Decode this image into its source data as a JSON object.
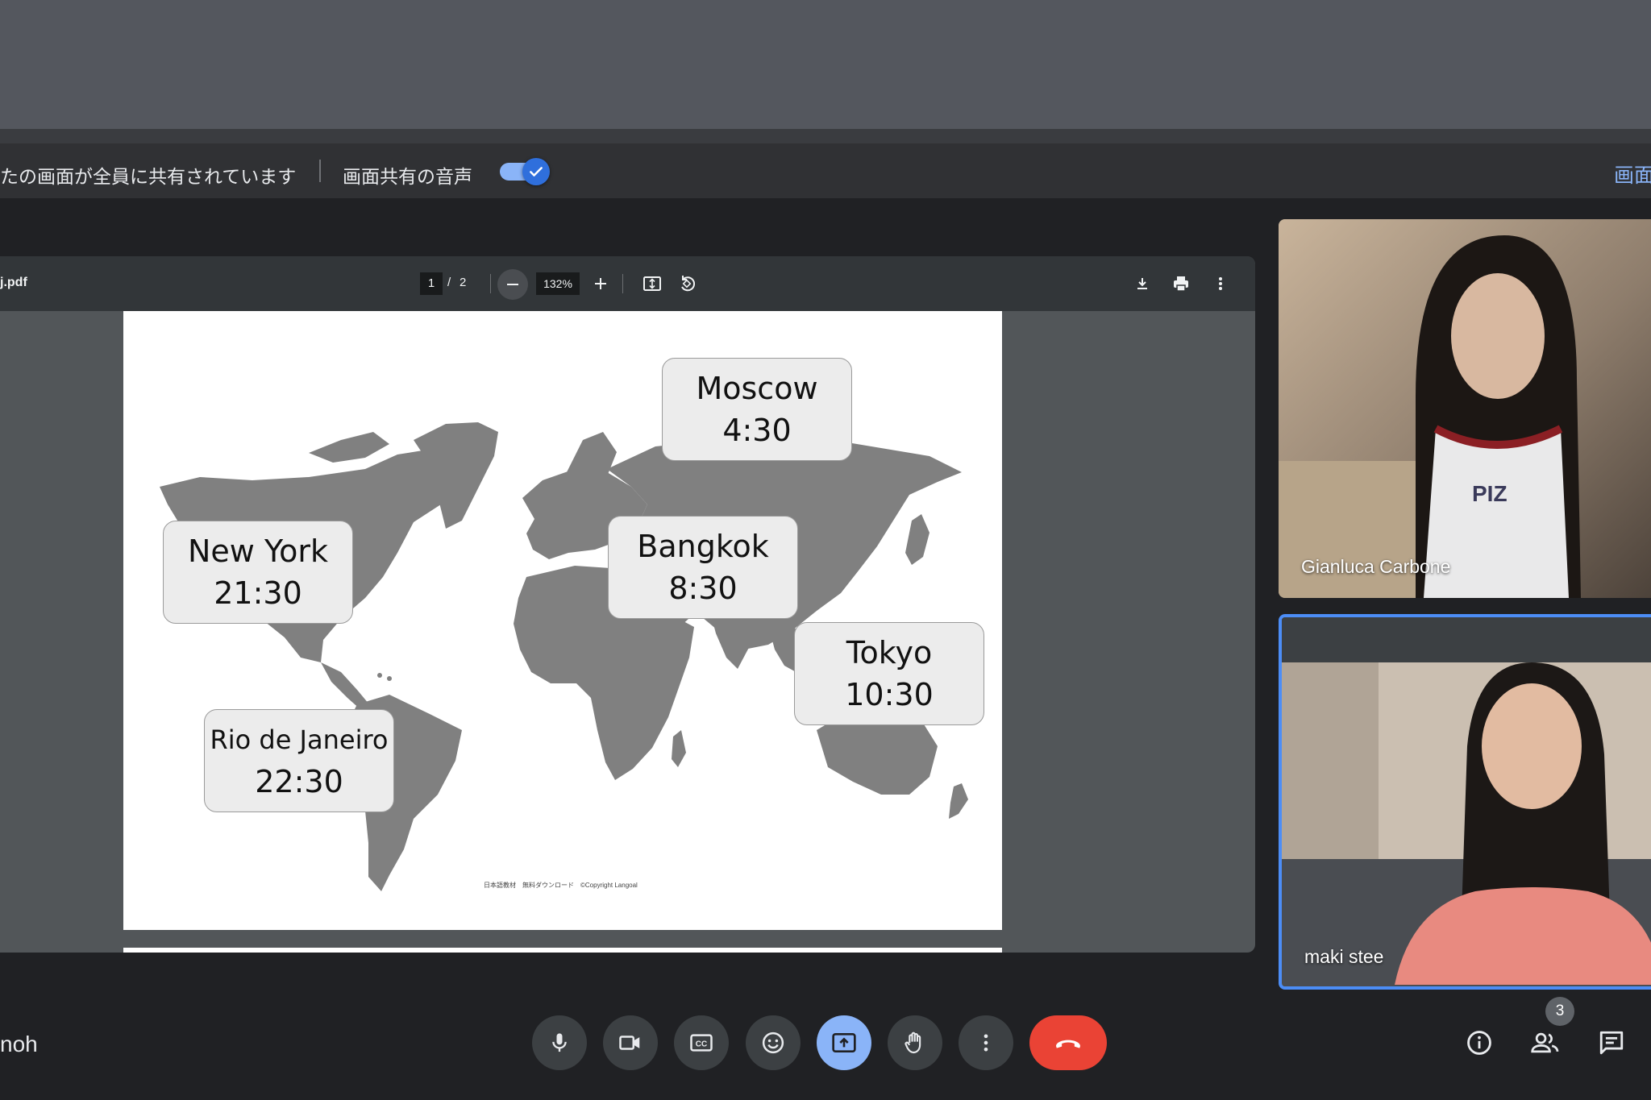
{
  "banner": {
    "share_message": "たの画面が全員に共有されています",
    "audio_label": "画面共有の音声",
    "audio_toggle_on": true,
    "right_link": "画面"
  },
  "pdf": {
    "filename": "j.pdf",
    "page_current": "1",
    "page_separator": "/",
    "page_total": "2",
    "zoom": "132%",
    "icons": [
      "zoom-out-icon",
      "zoom-in-icon",
      "fit-page-icon",
      "rotate-icon",
      "download-icon",
      "print-icon",
      "more-vert-icon"
    ]
  },
  "slide": {
    "cities": [
      {
        "name": "Moscow",
        "time": "4:30"
      },
      {
        "name": "New York",
        "time": "21:30"
      },
      {
        "name": "Bangkok",
        "time": "8:30"
      },
      {
        "name": "Tokyo",
        "time": "10:30"
      },
      {
        "name": "Rio de Janeiro",
        "time": "22:30"
      }
    ],
    "copyright": "日本語教材　無料ダウンロード　©Copyright Langoal"
  },
  "participants": [
    {
      "name": "Gianluca Carbone"
    },
    {
      "name": "maki stee"
    }
  ],
  "bottom_bar": {
    "self_name": "noh",
    "people_count": "3",
    "controls": [
      "mic-icon",
      "camera-icon",
      "captions-icon",
      "emoji-icon",
      "present-icon",
      "raise-hand-icon",
      "more-options-icon",
      "end-call-icon"
    ],
    "side_controls": [
      "info-icon",
      "people-icon",
      "chat-icon"
    ]
  },
  "colors": {
    "accent": "#8ab4f8",
    "end_call": "#ea4335",
    "active_tile_border": "#4c8df6"
  }
}
